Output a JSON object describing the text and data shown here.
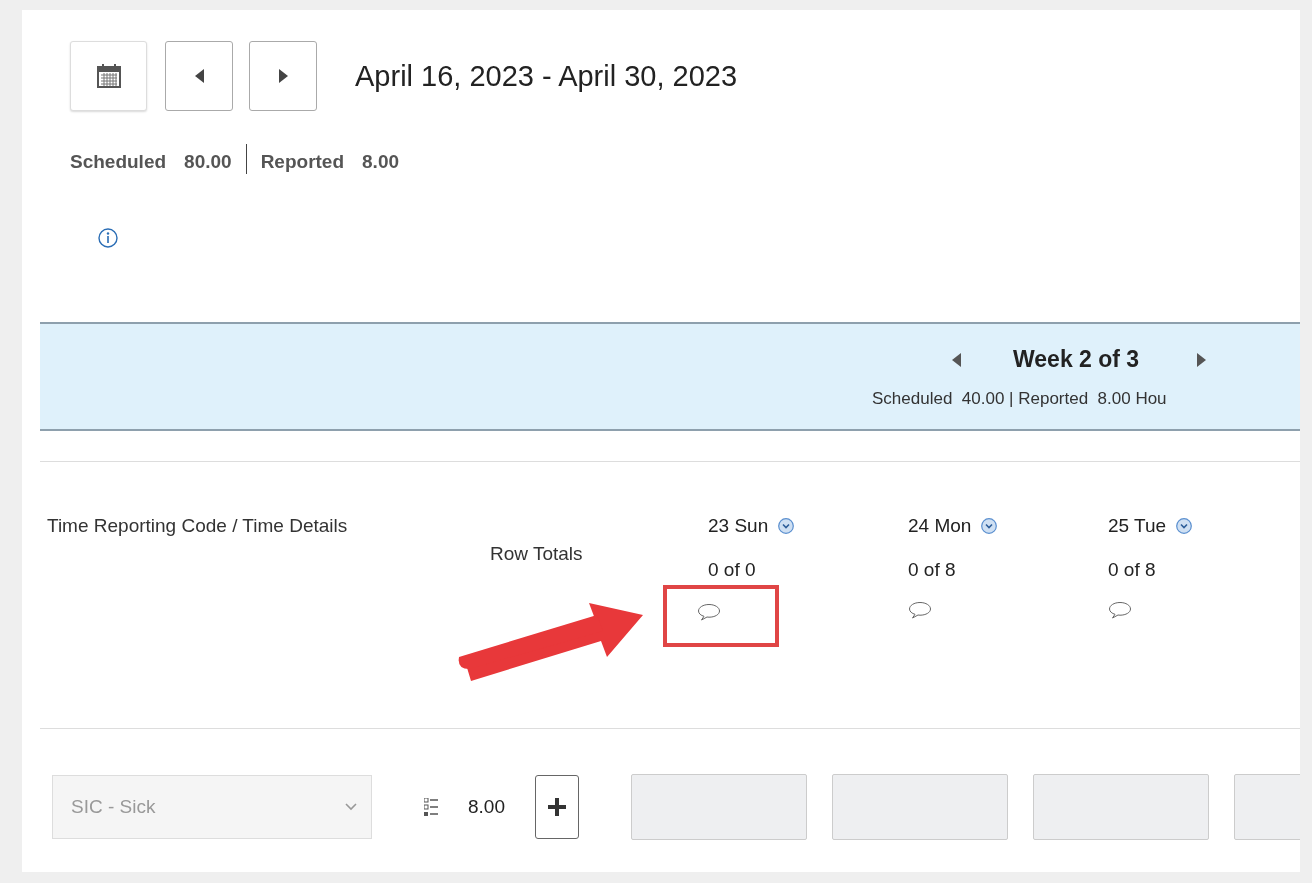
{
  "toolbar": {
    "date_range": "April 16, 2023 - April 30, 2023"
  },
  "summary": [
    {
      "label": "Scheduled",
      "value": "80.00"
    },
    {
      "label": "Reported",
      "value": "8.00"
    }
  ],
  "week": {
    "title": "Week 2 of 3",
    "summary": "Scheduled  40.00 | Reported  8.00 Hou"
  },
  "grid": {
    "column_1": "Time Reporting Code / Time Details",
    "row_totals": "Row Totals",
    "days": [
      {
        "label": "23 Sun",
        "hours": "0 of 0",
        "annotated": true
      },
      {
        "label": "24 Mon",
        "hours": "0 of 8",
        "annotated": false
      },
      {
        "label": "25 Tue",
        "hours": "0 of 8",
        "annotated": false
      }
    ]
  },
  "rows": [
    {
      "code": "SIC - Sick",
      "disabled": true,
      "total": "8.00",
      "cells": [
        {
          "disabled": true
        },
        {
          "disabled": true
        },
        {
          "disabled": true
        },
        {
          "disabled": true
        }
      ]
    }
  ]
}
